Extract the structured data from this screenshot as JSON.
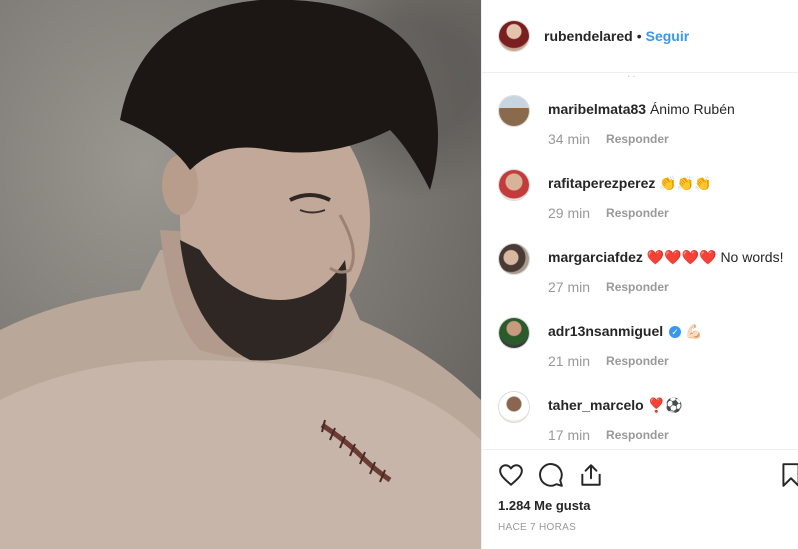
{
  "post": {
    "author": "rubendelared",
    "dot": "•",
    "follow_label": "Seguir",
    "likes": "1.284 Me gusta",
    "time_ago": "HACE 7 HORAS"
  },
  "comments": [
    {
      "user": "maribelmata83",
      "text": "Ánimo Rubén",
      "time": "34 min",
      "reply": "Responder",
      "verified": false
    },
    {
      "user": "rafitaperezperez",
      "text": "👏👏👏",
      "time": "29 min",
      "reply": "Responder",
      "verified": false
    },
    {
      "user": "margarciafdez",
      "text": "❤️❤️❤️❤️ No words!",
      "time": "27 min",
      "reply": "Responder",
      "verified": false
    },
    {
      "user": "adr13nsanmiguel",
      "text": "💪🏻",
      "time": "21 min",
      "reply": "Responder",
      "verified": true
    },
    {
      "user": "taher_marcelo",
      "text": "❣️⚽",
      "time": "17 min",
      "reply": "Responder",
      "verified": false
    }
  ],
  "icons": {
    "like": "heart-icon",
    "comment": "comment-bubble-icon",
    "share": "share-icon",
    "save": "bookmark-icon"
  },
  "colors": {
    "accent": "#3897f0",
    "muted": "#999999",
    "text": "#262626",
    "border": "#efefef"
  }
}
